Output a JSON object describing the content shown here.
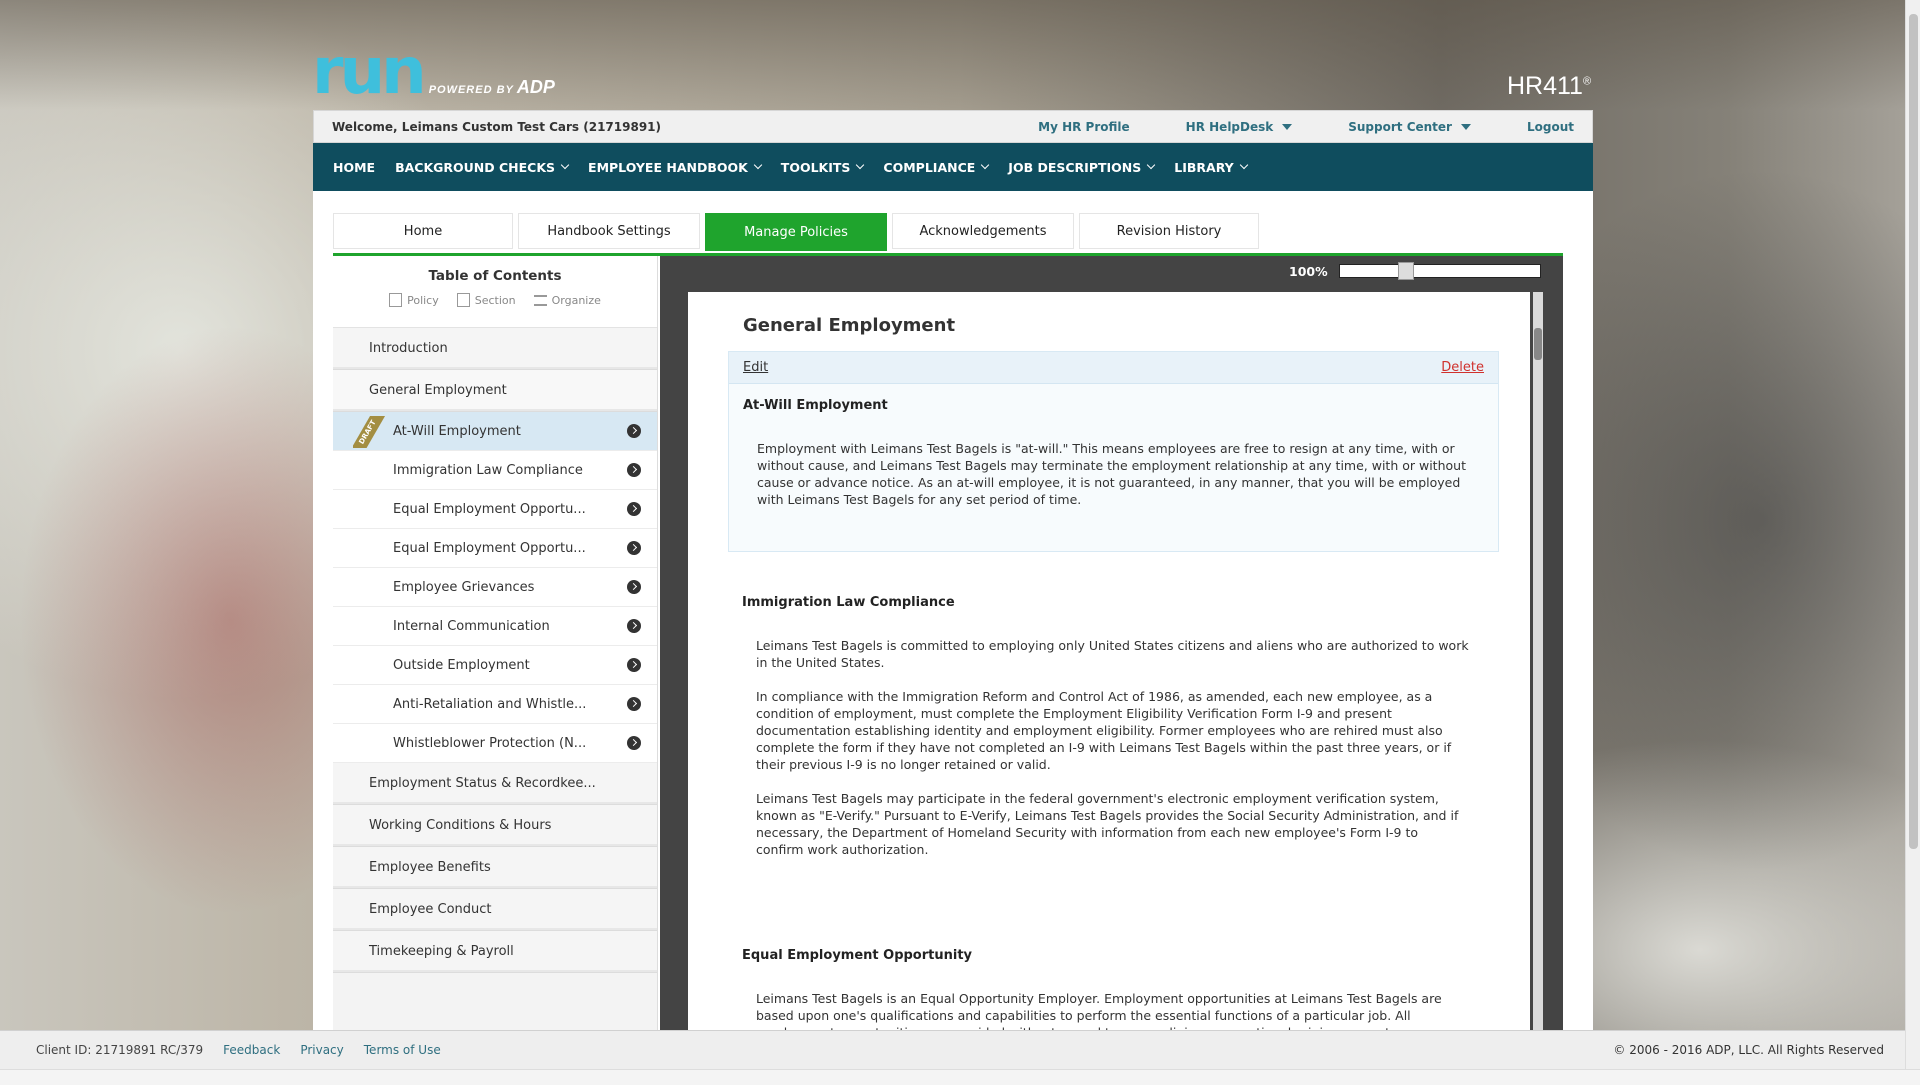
{
  "branding": {
    "logo_run": "run",
    "logo_powered": "POWERED BY",
    "logo_adp": "ADP",
    "product": "HR411",
    "product_mark": "®"
  },
  "topbar": {
    "welcome": "Welcome, Leimans Custom Test Cars (21719891)",
    "links": [
      "My HR Profile",
      "HR HelpDesk",
      "Support Center",
      "Logout"
    ]
  },
  "nav": {
    "items": [
      "HOME",
      "BACKGROUND CHECKS",
      "EMPLOYEE HANDBOOK",
      "TOOLKITS",
      "COMPLIANCE",
      "JOB DESCRIPTIONS",
      "LIBRARY"
    ]
  },
  "tabs": [
    "Home",
    "Handbook Settings",
    "Manage Policies",
    "Acknowledgements",
    "Revision History"
  ],
  "active_tab": "Manage Policies",
  "toc": {
    "title": "Table of Contents",
    "actions": [
      "Policy",
      "Section",
      "Organize"
    ],
    "sections_before": [
      "Introduction",
      "General Employment"
    ],
    "subitems": [
      "At-Will Employment",
      "Immigration Law Compliance",
      "Equal Employment Opportu...",
      "Equal Employment Opportu...",
      "Employee Grievances",
      "Internal Communication",
      "Outside Employment",
      "Anti-Retaliation and Whistle...",
      "Whistleblower Protection (N..."
    ],
    "draft_label": "DRAFT",
    "sections_after": [
      "Employment Status & Recordkee...",
      "Working Conditions & Hours",
      "Employee Benefits",
      "Employee Conduct",
      "Timekeeping & Payroll"
    ]
  },
  "viewer": {
    "zoom": "100%",
    "zoom_level_fraction": 0.4
  },
  "document": {
    "title": "General Employment",
    "edit_label": "Edit",
    "delete_label": "Delete",
    "policies": [
      {
        "title": "At-Will Employment",
        "paragraphs": [
          "Employment with Leimans Test Bagels is \"at-will.\" This means employees are free to resign at any time, with or without cause, and Leimans Test Bagels may terminate the employment relationship at any time, with or without cause or advance notice. As an at-will employee, it is not guaranteed, in any manner, that you will be employed with Leimans Test Bagels for any set period of time."
        ]
      },
      {
        "title": "Immigration Law Compliance",
        "paragraphs": [
          "Leimans Test Bagels is committed to employing only United States citizens and aliens who are authorized to work in the United States.",
          "In compliance with the Immigration Reform and Control Act of 1986, as amended, each new employee, as a condition of employment, must complete the Employment Eligibility Verification Form I-9 and present documentation establishing identity and employment eligibility. Former employees who are rehired must also complete the form if they have not completed an I-9 with Leimans Test Bagels within the past three years, or if their previous I-9 is no longer retained or valid.",
          "Leimans Test Bagels may participate in the federal government's electronic employment verification system, known as \"E-Verify.\" Pursuant to E-Verify, Leimans Test Bagels provides the Social Security Administration, and if necessary, the Department of Homeland Security with information from each new employee's Form I-9 to confirm work authorization."
        ]
      },
      {
        "title": "Equal Employment Opportunity",
        "paragraphs": [
          "Leimans Test Bagels is an Equal Opportunity Employer. Employment opportunities at Leimans Test Bagels are based upon one's qualifications and capabilities to perform the essential functions of a particular job.  All employment opportunities are provided without regard to race, religion, sex, national origin, age, veteran"
        ]
      }
    ]
  },
  "footer": {
    "client_id": "Client ID: 21719891 RC/379",
    "links": [
      "Feedback",
      "Privacy",
      "Terms of Use"
    ],
    "copyright": "© 2006 - 2016 ADP, LLC. All Rights Reserved"
  }
}
